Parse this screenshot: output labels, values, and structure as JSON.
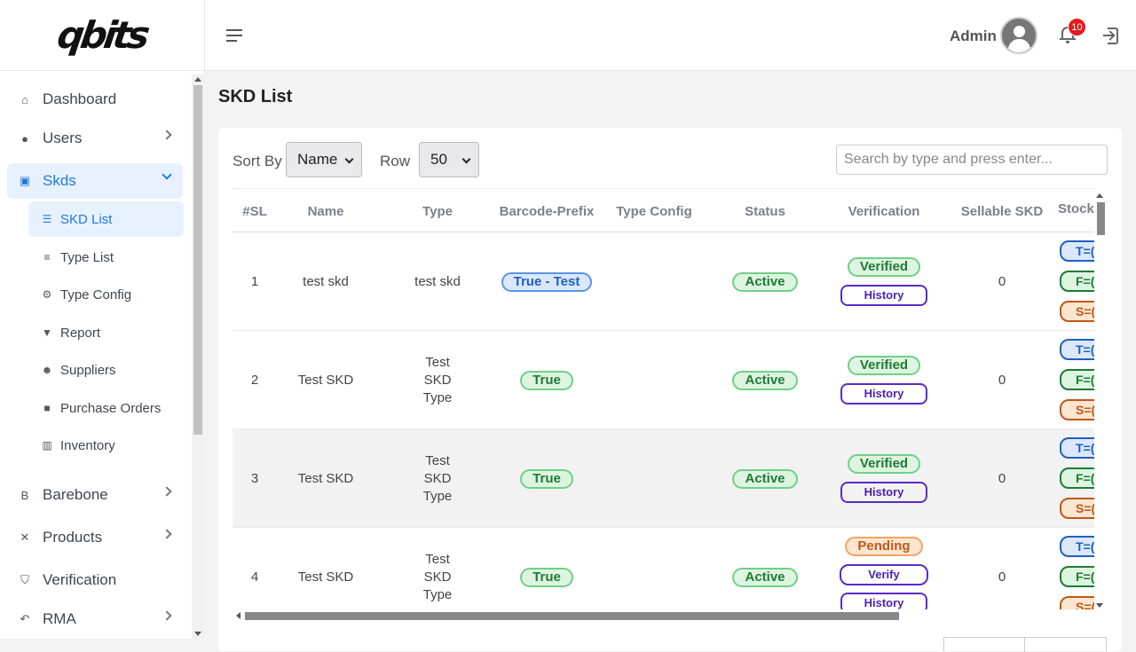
{
  "brand": {
    "logo_text": "qbits"
  },
  "header": {
    "admin_name": "Admin",
    "notification_count": "10"
  },
  "sidebar": {
    "items": [
      {
        "label": "Dashboard"
      },
      {
        "label": "Users"
      },
      {
        "label": "Skds"
      },
      {
        "label": "Barebone"
      },
      {
        "label": "Products"
      },
      {
        "label": "Verification"
      },
      {
        "label": "RMA"
      }
    ],
    "sub_items": [
      {
        "label": "SKD List"
      },
      {
        "label": "Type List"
      },
      {
        "label": "Type Config"
      },
      {
        "label": "Report"
      },
      {
        "label": "Suppliers"
      },
      {
        "label": "Purchase Orders"
      },
      {
        "label": "Inventory"
      }
    ]
  },
  "page": {
    "title": "SKD List"
  },
  "toolbar": {
    "sort_label": "Sort By",
    "sort_value": "Name",
    "row_label": "Row",
    "row_value": "50",
    "search_placeholder": "Search by type and press enter..."
  },
  "table": {
    "headers": [
      "#SL",
      "Name",
      "Type",
      "Barcode-Prefix",
      "Type Config",
      "Status",
      "Verification",
      "Sellable SKD",
      "Stock"
    ],
    "rows": [
      {
        "sl": "1",
        "name": "test skd",
        "type": "test skd",
        "barcode": "True - Test",
        "status": "Active",
        "verification": "Verified",
        "action": "History",
        "sellable": "0",
        "stock": [
          "T=(",
          "F=(",
          "S=("
        ]
      },
      {
        "sl": "2",
        "name": "Test SKD",
        "type": "Test SKD Type",
        "barcode": "True",
        "status": "Active",
        "verification": "Verified",
        "action": "History",
        "sellable": "0",
        "stock": [
          "T=(",
          "F=(",
          "S=("
        ]
      },
      {
        "sl": "3",
        "name": "Test SKD",
        "type": "Test SKD Type",
        "barcode": "True",
        "status": "Active",
        "verification": "Verified",
        "action": "History",
        "sellable": "0",
        "stock": [
          "T=(",
          "F=(",
          "S=("
        ]
      },
      {
        "sl": "4",
        "name": "Test SKD",
        "type": "Test SKD Type",
        "barcode": "True",
        "status": "Active",
        "verification": "Pending",
        "action": "Verify",
        "action2": "History",
        "sellable": "0",
        "stock": [
          "T=(",
          "F=(",
          "S=("
        ]
      }
    ]
  },
  "colors": {
    "accent": "#1f7ae0",
    "active_bg": "#e7f1fe",
    "badge_red": "#e31b1b"
  }
}
